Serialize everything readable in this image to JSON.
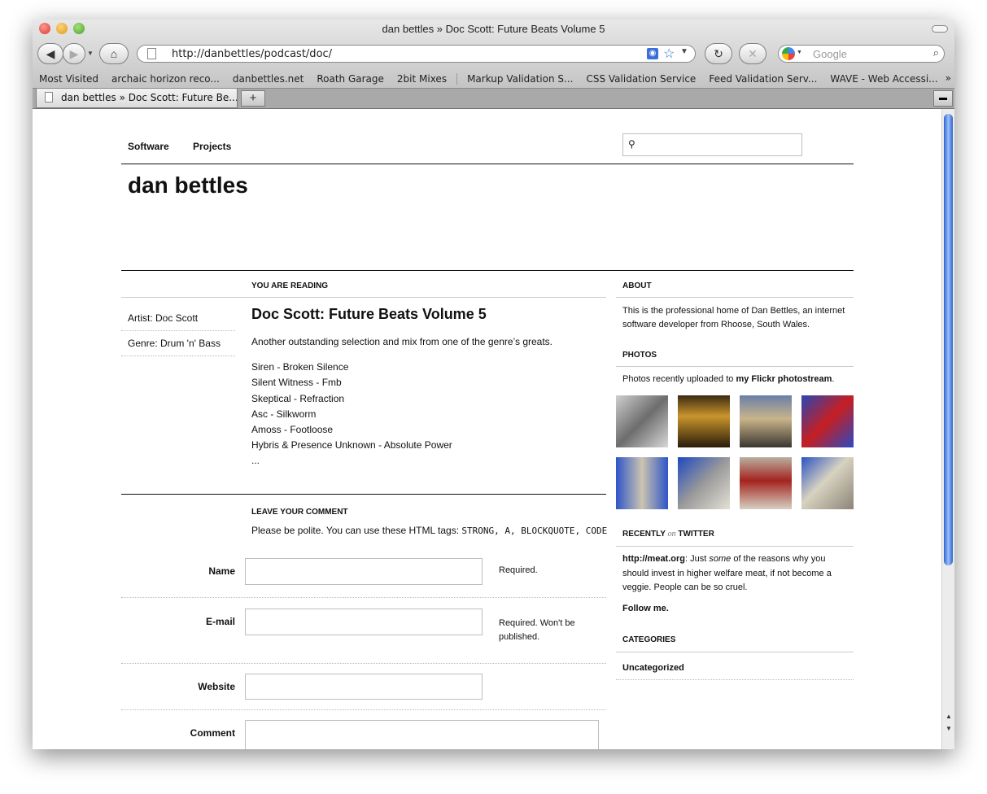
{
  "browser": {
    "title": "dan bettles » Doc Scott: Future Beats Volume 5",
    "url": "http://danbettles/podcast/doc/",
    "search_placeholder": "Google",
    "bookmarks": [
      "Most Visited",
      "archaic horizon reco...",
      "danbettles.net",
      "Roath Garage",
      "2bit Mixes",
      "Markup Validation S...",
      "CSS Validation Service",
      "Feed Validation Serv...",
      "WAVE - Web Accessi..."
    ],
    "tab_label": "dan bettles » Doc Scott: Future Be..."
  },
  "site": {
    "nav": [
      "Software",
      "Projects"
    ],
    "title": "dan bettles"
  },
  "post": {
    "section_label": "YOU ARE READING",
    "meta": [
      "Artist: Doc Scott",
      "Genre: Drum 'n' Bass"
    ],
    "title": "Doc Scott: Future Beats Volume 5",
    "intro": "Another outstanding selection and mix from one of the genre’s greats.",
    "tracks": [
      "Siren - Broken Silence",
      "Silent Witness - Fmb",
      "Skeptical - Refraction",
      "Asc - Silkworm",
      "Amoss - Footloose",
      "Hybris & Presence Unknown - Absolute Power",
      "..."
    ]
  },
  "comment": {
    "heading": "LEAVE YOUR COMMENT",
    "intro": "Please be polite. You can use these HTML tags:",
    "tags": "STRONG, A, BLOCKQUOTE, CODE",
    "name_label": "Name",
    "name_note": "Required.",
    "email_label": "E-mail",
    "email_note": "Required. Won't be published.",
    "website_label": "Website",
    "comment_label": "Comment"
  },
  "sidebar": {
    "about_heading": "ABOUT",
    "about_text": "This is the professional home of Dan Bettles, an internet software developer from Rhoose, South Wales.",
    "photos_heading": "PHOTOS",
    "photos_text_pre": "Photos recently uploaded to",
    "photos_link": "my Flickr photostream",
    "photos_text_post": ".",
    "twitter_heading_a": "RECENTLY",
    "twitter_heading_on": "on",
    "twitter_heading_b": "TWITTER",
    "tweet_link": "http://meat.org",
    "tweet_text_a": ": Just",
    "tweet_text_em": "some",
    "tweet_text_b": "of the reasons why you should invest in higher welfare meat, if not become a veggie. People can be so cruel.",
    "follow": "Follow me.",
    "categories_heading": "CATEGORIES",
    "category": "Uncategorized"
  },
  "colors": {
    "accent_scroll": "#2b63d6",
    "rule": "#111111"
  }
}
